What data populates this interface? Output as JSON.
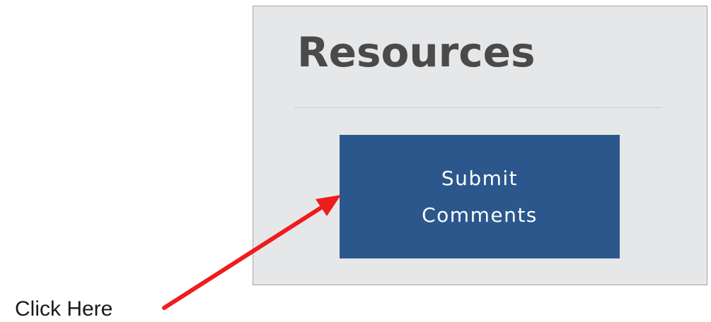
{
  "panel": {
    "title": "Resources",
    "button": {
      "line1": "Submit",
      "line2": "Comments"
    }
  },
  "annotation": {
    "label": "Click Here",
    "arrow_color": "#ee1c1c"
  },
  "colors": {
    "panel_background": "#e6e7e9",
    "button_background": "#2b578c",
    "title_text": "#4a4a4a"
  },
  "icons": [
    "arrow-annotation-icon"
  ]
}
